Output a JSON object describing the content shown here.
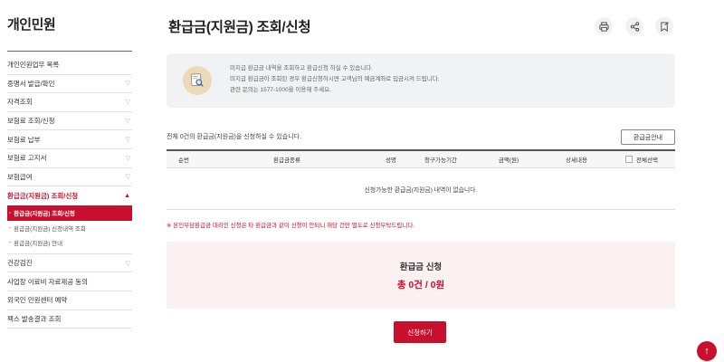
{
  "sidebar": {
    "title": "개인민원",
    "items": [
      {
        "label": "개인민원업무 목록",
        "chevron": ""
      },
      {
        "label": "증명서 발급/확인",
        "chevron": "▽"
      },
      {
        "label": "자격조회",
        "chevron": "▽"
      },
      {
        "label": "보험료 조회/신청",
        "chevron": "▽"
      },
      {
        "label": "보험료 납부",
        "chevron": "▽"
      },
      {
        "label": "보험료 고지서",
        "chevron": "▽"
      },
      {
        "label": "보험급여",
        "chevron": "▽"
      },
      {
        "label": "환급금(지원금) 조회/신청",
        "chevron": "▲"
      }
    ],
    "sub_items": [
      {
        "label": "환급금(지원금) 조회/신청",
        "dash": "-"
      },
      {
        "label": "환급금(지원금) 신청내역 조회",
        "dash": "-"
      },
      {
        "label": "환급금(지원금) 안내",
        "dash": "-"
      }
    ],
    "items_after": [
      {
        "label": "건강검진",
        "chevron": "▽"
      },
      {
        "label": "사업장 이료비 자료제공 동의",
        "chevron": ""
      },
      {
        "label": "외국인 민원센터 예약",
        "chevron": ""
      },
      {
        "label": "팩스 발송결과 조회",
        "chevron": ""
      }
    ]
  },
  "page": {
    "title": "환급금(지원금) 조회/신청",
    "tools": {
      "print": "print-icon",
      "share": "share-icon",
      "bookmark": "bookmark-icon"
    }
  },
  "info": {
    "icon": "magnifier-icon",
    "lines": [
      "미지급 환급금 내역을 조회하고 환급신청 하실 수 있습니다.",
      "미지급 환급금이 조회된 경우 환급신청하시면 고객님의 예금계좌로 입금시켜 드립니다.",
      "관련 문의는 1577-1000을 이용해 주세요."
    ]
  },
  "list": {
    "count_text": "전체 0건의 환급금(지원금)을 신청하실 수 있습니다.",
    "guide_button": "환급금안내",
    "columns": [
      "순번",
      "환급금종류",
      "성명",
      "청구가능기간",
      "금액(원)",
      "상세내용",
      "전체선택"
    ],
    "empty_message": "신청가능한 환급금(지원금) 내역이 없습니다."
  },
  "notice": "※ 본인부담환급금 대리인 신청은 타 환급금과 같이 신청이 안되니 해당 건만 별도로 신청부탁드립니다.",
  "summary": {
    "title": "환급금 신청",
    "total": "총 0건 / 0원"
  },
  "apply_button": "신청하기",
  "top_button": "↑",
  "colors": {
    "accent": "#c8102e",
    "info_bg": "#f1f2f4",
    "summary_bg": "#fcf1f1"
  }
}
